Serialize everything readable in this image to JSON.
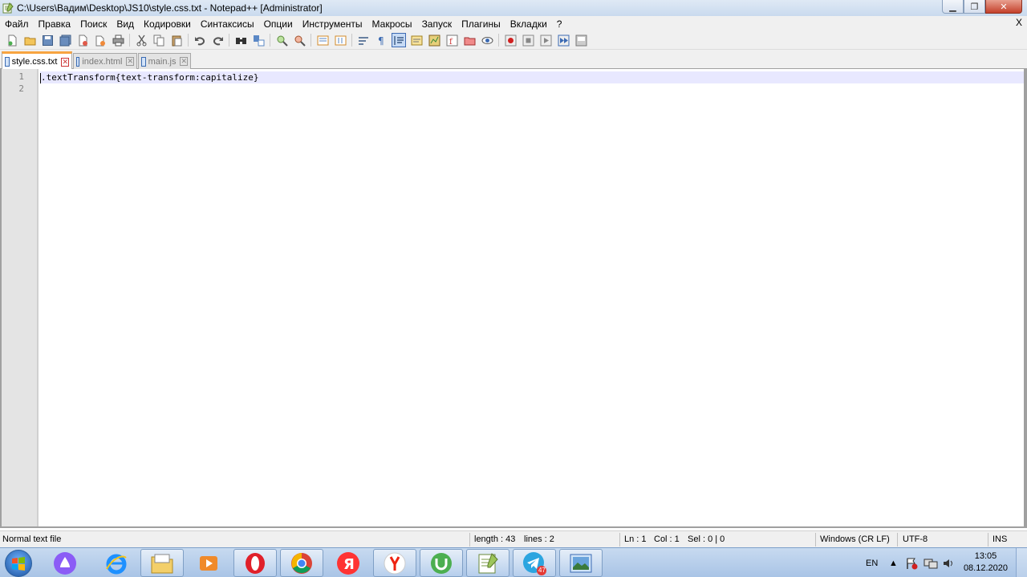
{
  "window": {
    "title": "C:\\Users\\Вадим\\Desktop\\JS10\\style.css.txt - Notepad++ [Administrator]",
    "min_icon": "minimize-icon",
    "max_icon": "maximize-icon",
    "close_icon": "close-icon"
  },
  "menu": {
    "items": [
      "Файл",
      "Правка",
      "Поиск",
      "Вид",
      "Кодировки",
      "Синтаксисы",
      "Опции",
      "Инструменты",
      "Макросы",
      "Запуск",
      "Плагины",
      "Вкладки",
      "?"
    ],
    "close_label": "X"
  },
  "tabs": [
    {
      "label": "style.css.txt",
      "active": true
    },
    {
      "label": "index.html",
      "active": false
    },
    {
      "label": "main.js",
      "active": false
    }
  ],
  "editor": {
    "lines": [
      {
        "number": "1",
        "text": ".textTransform{text-transform:capitalize}"
      },
      {
        "number": "2",
        "text": ""
      }
    ]
  },
  "status": {
    "file_type": "Normal text file",
    "length": "length : 43",
    "lines": "lines : 2",
    "ln": "Ln : 1",
    "col": "Col : 1",
    "sel": "Sel : 0 | 0",
    "eol": "Windows (CR LF)",
    "encoding": "UTF-8",
    "mode": "INS"
  },
  "taskbar": {
    "lang": "EN",
    "time": "13:05",
    "date": "08.12.2020",
    "telegram_badge": "47",
    "tray_up_icon": "tray-expand-icon"
  },
  "colors": {
    "tab_accent": "#f7a440",
    "current_line": "#e8e8ff",
    "gutter": "#e4e4e4"
  }
}
